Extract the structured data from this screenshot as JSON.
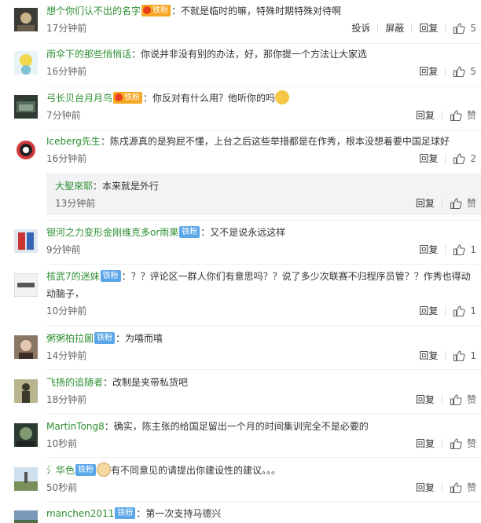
{
  "labels": {
    "report": "投诉",
    "block": "屏蔽",
    "reply": "回复",
    "like_text": "赞"
  },
  "badges": {
    "gold": "铁粉",
    "iron": "铁粉"
  },
  "comments": [
    {
      "user": "想个你们认不出的名字",
      "text": "：不就是临时的嘛，特殊时期特殊对待啊",
      "time": "17分钟前",
      "likes": "5"
    },
    {
      "user": "雨伞下的那些悄悄话",
      "text": "：你说并非没有别的办法，好，那你提一个方法让大家选",
      "time": "16分钟前",
      "likes": "5"
    },
    {
      "user": "弓长贝台月月鸟",
      "text": "：你反对有什么用？他听你的吗",
      "time": "7分钟前",
      "likes": "赞"
    },
    {
      "user": "Iceberg先生",
      "text": "：陈戌源真的是狗屁不懂，上台之后这些举措都是在作秀，根本没想着要中国足球好",
      "time": "16分钟前",
      "likes": "2"
    },
    {
      "user": "大聖來耶",
      "text": "：本来就是外行",
      "time": "13分钟前",
      "likes": "赞"
    },
    {
      "user": "银河之力变形金刚维克多or雨果",
      "text": "：又不是说永远这样",
      "time": "9分钟前",
      "likes": "1"
    },
    {
      "user": "核武7的迷妹",
      "text": "：？？评论区一群人你们有意思吗？？说了多少次联赛不归程序员管？？作秀也得动动脑子，",
      "time": "10分钟前",
      "likes": "1"
    },
    {
      "user": "粥粥柏拉圖",
      "text": "：为嘻而嘻",
      "time": "14分钟前",
      "likes": "1"
    },
    {
      "user": "飞扬的追随者",
      "text": "：改制是夹带私货吧",
      "time": "18分钟前",
      "likes": "赞"
    },
    {
      "user": "MartinTong8",
      "text": "：确实，陈主张的给国足留出一个月的时间集训完全不是必要的",
      "time": "10秒前",
      "likes": "赞"
    },
    {
      "user": "氵华色",
      "text": "有不同意见的请提出你建设性的建议。。。",
      "time": "50秒前",
      "likes": "赞"
    },
    {
      "user": "manchen2011",
      "text": "：第一次支持马德兴",
      "time": "",
      "likes": ""
    }
  ],
  "colors": {
    "username": "#2d8f32",
    "gold_badge": "#f5a623",
    "iron_badge": "#5ba6e8",
    "reply_bg": "#f3f3f5"
  },
  "icons": [
    "thumbs-up-icon",
    "avatar",
    "emoji-icon"
  ]
}
